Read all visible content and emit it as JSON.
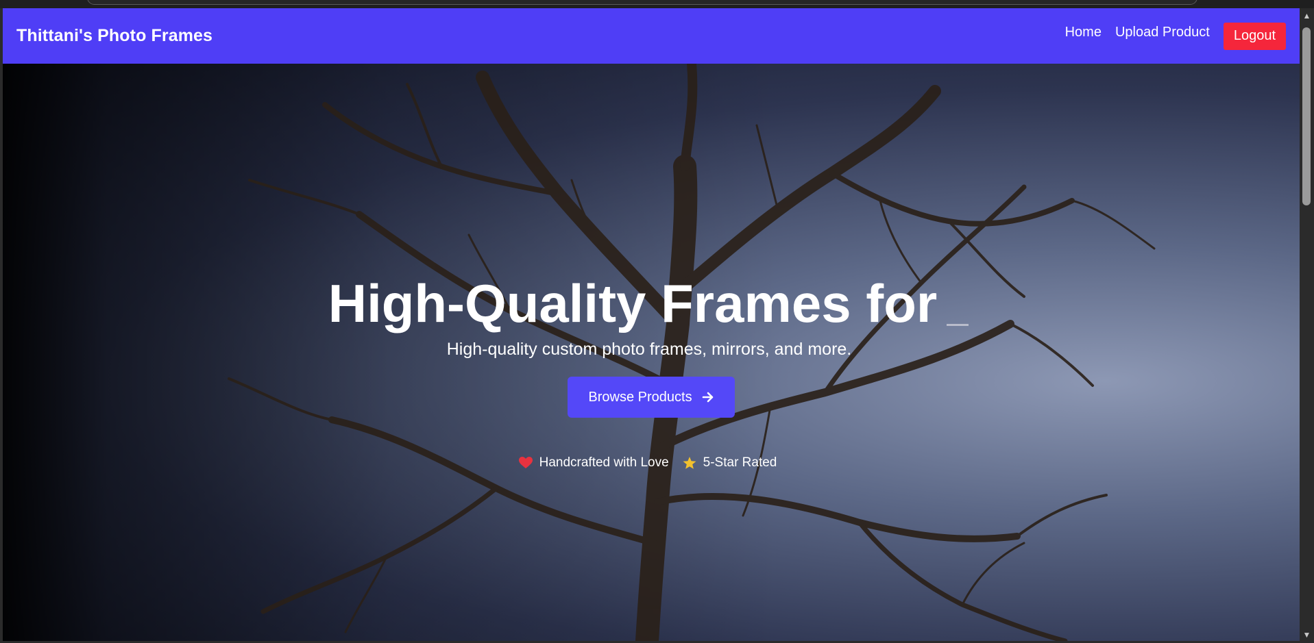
{
  "navbar": {
    "brand": "Thittani's Photo Frames",
    "links": [
      "Home",
      "Upload Product"
    ],
    "logout_label": "Logout",
    "bg_color": "#4f3ef6",
    "logout_color": "#f5263b"
  },
  "hero": {
    "title": "High-Quality Frames for",
    "subtitle": "High-quality custom photo frames, mirrors, and more.",
    "cta_label": "Browse Products",
    "cta_icon": "arrow-right-icon",
    "badges": [
      {
        "icon": "heart-icon",
        "label": "Handcrafted with Love",
        "color": "#e8323f"
      },
      {
        "icon": "star-icon",
        "label": "5-Star Rated",
        "color": "#f2c12e"
      }
    ],
    "button_color": "#5448f8"
  },
  "scrollbar": {
    "up_icon": "scroll-up-arrow-icon",
    "down_icon": "scroll-down-arrow-icon"
  }
}
